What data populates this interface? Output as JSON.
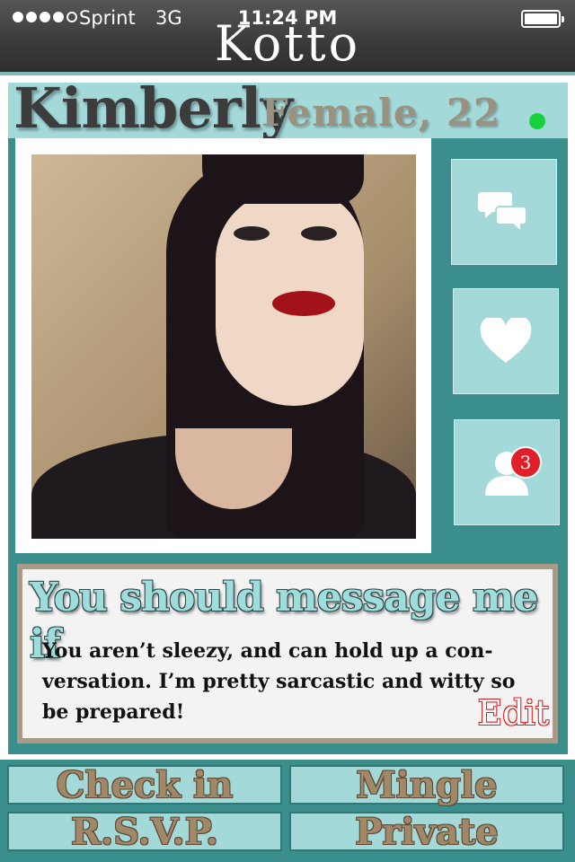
{
  "status_bar": {
    "carrier": "Sprint",
    "network": "3G",
    "time": "11:24 PM"
  },
  "app": {
    "title": "Kotto"
  },
  "profile": {
    "name": "Kimberly",
    "gender_age": "Female, 22",
    "online_color": "#16d23b"
  },
  "actions": {
    "chat_icon": "chat-bubbles-icon",
    "like_icon": "heart-icon",
    "visitors_icon": "person-icon",
    "visitors_badge": "3"
  },
  "message": {
    "title": "You should message me if",
    "body": "You aren’t sleezy, and can hold up a con-versation. I’m pretty sarcastic and witty so be prepared!",
    "edit_label": "Edit"
  },
  "bottom_buttons": {
    "check_in": "Check in",
    "mingle": "Mingle",
    "rsvp": "R.S.V.P.",
    "private": "Private"
  },
  "colors": {
    "teal": "#3a8f8c",
    "light_teal": "#a4d9da",
    "header": "#3a3a3a"
  }
}
